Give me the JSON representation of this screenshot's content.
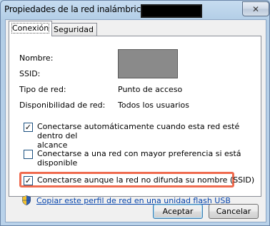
{
  "window": {
    "title": "Propiedades de la red inalámbrica",
    "close_glyph": "✕"
  },
  "tabs": [
    {
      "label": "Conexión",
      "active": true
    },
    {
      "label": "Seguridad",
      "active": false
    }
  ],
  "fields": {
    "name_label": "Nombre:",
    "ssid_label": "SSID:",
    "network_type_label": "Tipo de red:",
    "network_type_value": "Punto de acceso",
    "availability_label": "Disponibilidad de red:",
    "availability_value": "Todos los usuarios"
  },
  "options": {
    "auto_connect": {
      "checked": true,
      "line1": "Conectarse automáticamente cuando esta red esté dentro del",
      "line2": "alcance"
    },
    "prefer_other": {
      "checked": false,
      "text": "Conectarse a una red con mayor preferencia si está disponible"
    },
    "hidden_ssid": {
      "checked": true,
      "text": "Conectarse aunque la red no difunda su nombre (SSID)"
    }
  },
  "link": {
    "text": "Copiar este perfil de red en una unidad flash USB",
    "icon": "uac-shield-icon"
  },
  "buttons": {
    "accept": "Aceptar",
    "cancel": "Cancelar"
  },
  "colors": {
    "highlight": "#ef6b4f",
    "link": "#0645ad"
  }
}
